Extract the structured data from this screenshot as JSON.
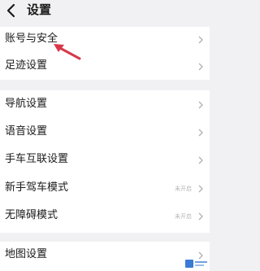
{
  "header": {
    "title": "设置"
  },
  "groups": [
    {
      "rows": [
        {
          "label": "账号与安全"
        },
        {
          "label": "足迹设置"
        }
      ]
    },
    {
      "rows": [
        {
          "label": "导航设置"
        },
        {
          "label": "语音设置"
        },
        {
          "label": "手车互联设置"
        },
        {
          "label": "新手驾车模式",
          "status": "未开启"
        },
        {
          "label": "无障碍模式",
          "status": "未开启"
        }
      ]
    },
    {
      "rows": [
        {
          "label": "地图设置"
        }
      ]
    }
  ],
  "colors": {
    "annotation_arrow": "#d63a4a",
    "chevron": "#b0b0b0",
    "background": "#f1f1f3"
  },
  "icons": {
    "back": "chevron-left-icon",
    "row_chevron": "chevron-right-icon"
  }
}
